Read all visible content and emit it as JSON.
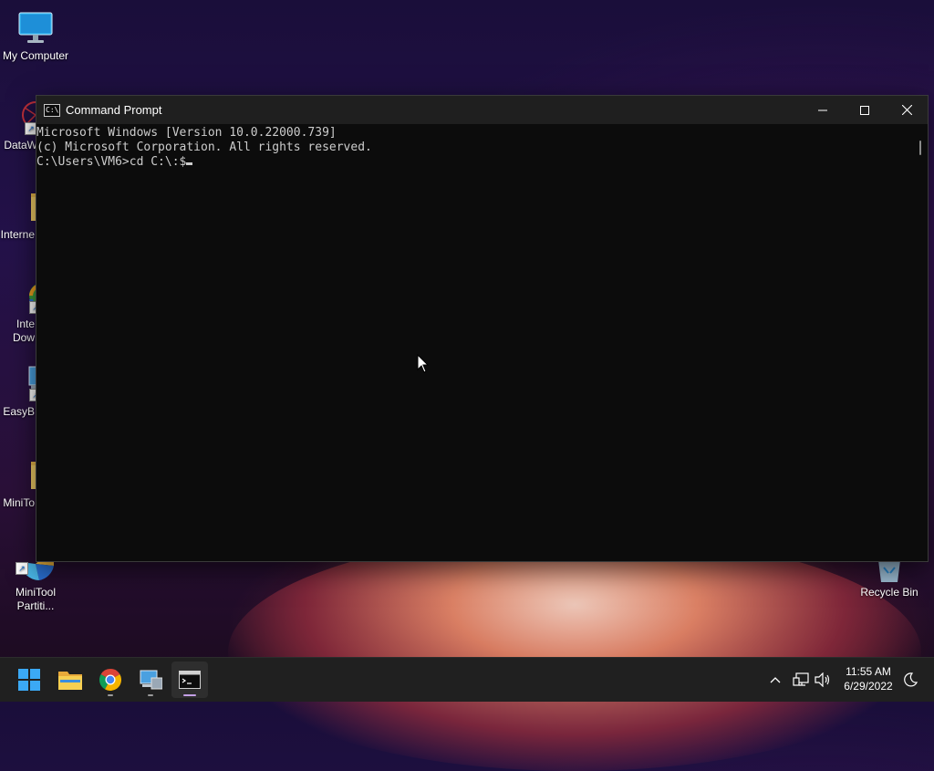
{
  "desktop": {
    "icons": [
      {
        "label": "My Computer"
      },
      {
        "label": "DataW"
      },
      {
        "label": "Interne"
      },
      {
        "label": "Inte\nDow"
      },
      {
        "label": "EasyB"
      },
      {
        "label": "MiniTo"
      },
      {
        "label": "MiniTool\nPartiti..."
      },
      {
        "label": "Recycle Bin"
      }
    ]
  },
  "window": {
    "title": "Command Prompt",
    "icon_text": "C:\\",
    "controls": {
      "minimize": "minimize-icon",
      "maximize": "maximize-icon",
      "close": "close-icon"
    },
    "console_lines": [
      "Microsoft Windows [Version 10.0.22000.739]",
      "(c) Microsoft Corporation. All rights reserved.",
      "",
      "C:\\Users\\VM6>cd C:\\:$"
    ]
  },
  "taskbar": {
    "apps": [
      {
        "name": "start",
        "icon": "windows-logo-icon"
      },
      {
        "name": "file-explorer",
        "icon": "folder-icon"
      },
      {
        "name": "chrome",
        "icon": "chrome-icon"
      },
      {
        "name": "easybcd",
        "icon": "computer-icon"
      },
      {
        "name": "command-prompt",
        "icon": "terminal-icon"
      }
    ],
    "clock": {
      "time": "11:55 AM",
      "date": "6/29/2022"
    }
  },
  "colors": {
    "console_bg": "#0c0c0c",
    "console_text": "#cccccc",
    "titlebar": "#1f1f1f",
    "taskbar": "#202020"
  }
}
